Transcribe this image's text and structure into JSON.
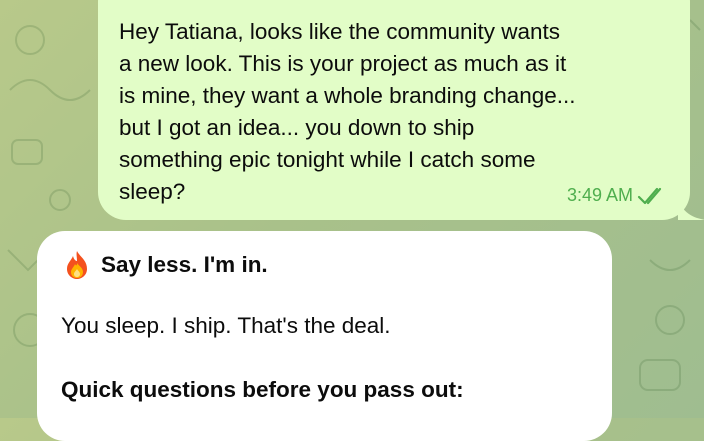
{
  "outgoing_message": {
    "text": "Hey Tatiana, looks like the community wants\na new look. This is your project as much as it\nis mine, they want a whole branding change...\nbut I got an idea... you down to ship\nsomething epic tonight while I catch some\nsleep?",
    "time": "3:49 AM",
    "status_icon": "double-check-icon",
    "status_color": "#4fae4e"
  },
  "incoming_message": {
    "icon": "fire-icon",
    "heading": "Say less. I'm in.",
    "line2": "You sleep. I ship. That's the deal.",
    "line3": "Quick questions before you pass out:"
  },
  "colors": {
    "outgoing_bubble": "#e2fdc7",
    "incoming_bubble": "#ffffff",
    "wallpaper": "#a9c18a"
  }
}
